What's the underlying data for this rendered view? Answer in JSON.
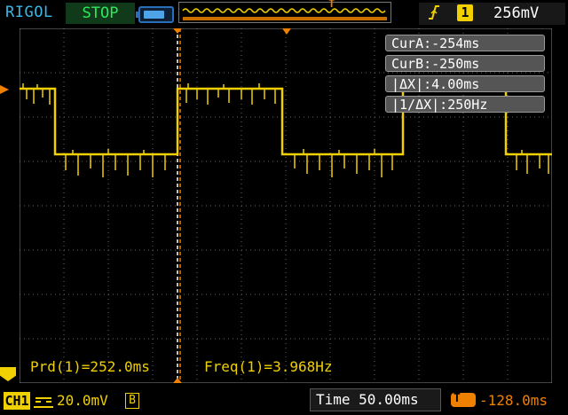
{
  "header": {
    "brand": "RIGOL",
    "run_state": "STOP",
    "trigger_marker": "T",
    "trigger_channel": "1",
    "trigger_level": "256mV",
    "colors": {
      "brand": "#37b8e8",
      "stop": "#2fe85a",
      "channel1": "#f0d000",
      "trigger": "#f08000"
    }
  },
  "cursors": {
    "cur_a": "CurA:-254ms",
    "cur_b": "CurB:-250ms",
    "delta_x": "|ΔX|:4.00ms",
    "inv_delta_x": "|1/ΔX|:250Hz"
  },
  "measurements": {
    "period": "Prd(1)=252.0ms",
    "frequency": "Freq(1)=3.968Hz"
  },
  "footer": {
    "channel_label": "CH1",
    "vertical_scale": "20.0mV",
    "bandwidth_badge": "B",
    "timebase": "Time 50.00ms",
    "trigger_position": "-128.0ms"
  },
  "waveform": {
    "type": "square",
    "channel": "CH1",
    "period": "252.0ms",
    "frequency": "3.968Hz"
  },
  "icons": {
    "battery": "battery-icon",
    "trigger_edge": "rising-edge-icon",
    "ground_marker": "channel-ground-icon",
    "coupling": "dc-coupling-icon"
  }
}
